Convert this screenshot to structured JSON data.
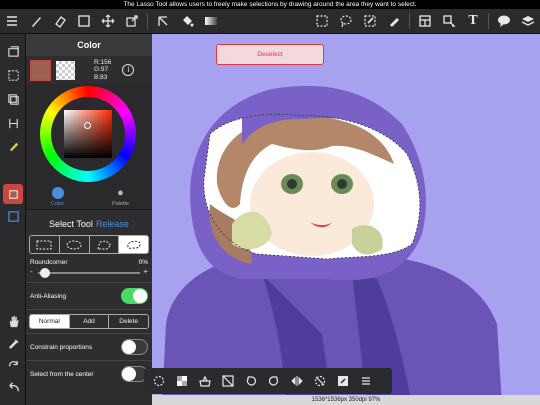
{
  "hint_bar": {
    "text": "The Lasso Tool allows users to freely make selections by drawing around the area they want to select."
  },
  "toolbar": {
    "left_tools": [
      "menu-icon",
      "brush-icon",
      "eraser-icon",
      "square-shape-icon",
      "move-icon",
      "transform-icon",
      "fill-icon",
      "bucket-icon",
      "gradient-icon"
    ],
    "right_tools": [
      "selection-rect-icon",
      "lasso-icon",
      "magic-wand-icon",
      "select-pen-icon",
      "layers-frame-icon",
      "operation-icon",
      "text-icon",
      "comment-icon",
      "layers-icon"
    ],
    "text_tool_glyph": "T"
  },
  "color_panel": {
    "title": "Color",
    "main_color": "#9c6153",
    "rgb": {
      "r": "R:156",
      "g": "G:97",
      "b": "B:83"
    },
    "info_glyph": "i",
    "tabs": [
      {
        "label": "Color",
        "active": true
      },
      {
        "label": "Palette",
        "active": false
      }
    ]
  },
  "select_tool": {
    "title": "Select Tool",
    "release_label": "Release",
    "roundcorner_label": "Roundcorner",
    "roundcorner_value": "0%",
    "roundcorner_level": 0,
    "anti_aliasing_label": "Anti-Aliasing",
    "anti_aliasing_on": true,
    "modes": [
      "Normal",
      "Add",
      "Delete"
    ],
    "active_mode": "Normal",
    "constrain_label": "Constrain proportions",
    "constrain_on": false,
    "center_label": "Select from the center",
    "center_on": false,
    "minus": "-",
    "plus": "+"
  },
  "canvas": {
    "deselect_label": "Deselect",
    "background": "#a6a2f0",
    "status": "1536*1536px 350dpi 97%"
  },
  "float_toolbar": {
    "tools": [
      "lasso-rotate-icon",
      "transparency-icon",
      "bucket-clear-icon",
      "cut-icon",
      "undo-icon",
      "redo-icon",
      "flip-icon",
      "deselect-icon",
      "edit-icon",
      "menu-icon"
    ]
  },
  "colors": {
    "accent": "#4a90d9",
    "active_red": "#c9473f",
    "toggle_on": "#4cd964",
    "deselect_red": "#e03b3b"
  }
}
